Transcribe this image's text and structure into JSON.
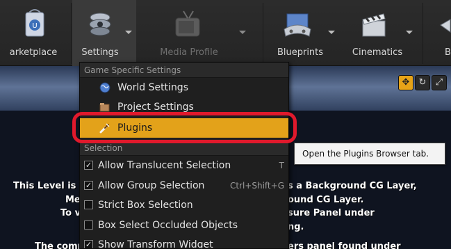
{
  "toolbar": {
    "buttons": [
      {
        "label": "arketplace",
        "icon": "marketplace-icon"
      },
      {
        "label": "Settings",
        "icon": "gear-icon"
      },
      {
        "label": "Media Profile",
        "icon": "media-profile-icon"
      },
      {
        "label": "Blueprints",
        "icon": "blueprints-icon"
      },
      {
        "label": "Cinematics",
        "icon": "clapperboard-icon"
      },
      {
        "label": "B",
        "icon": "build-icon"
      }
    ]
  },
  "menu": {
    "game_section": "Game Specific Settings",
    "world_settings": "World Settings",
    "project_settings": "Project Settings",
    "plugins": "Plugins",
    "selection_section": "Selection",
    "selection_items": [
      {
        "label": "Allow Translucent Selection",
        "shortcut": "T",
        "checked": true
      },
      {
        "label": "Allow Group Selection",
        "shortcut": "Ctrl+Shift+G",
        "checked": true
      },
      {
        "label": "Strict Box Selection",
        "shortcut": "",
        "checked": false
      },
      {
        "label": "Box Select Occluded Objects",
        "shortcut": "",
        "checked": false
      },
      {
        "label": "Show Transform Widget",
        "shortcut": "",
        "checked": true
      }
    ]
  },
  "tooltip": "Open the Plugins Browser tab.",
  "viewport": {
    "left_lines": [
      "This Level is s",
      "Me",
      "To vi",
      "The comp"
    ],
    "right_lines": [
      "s a Background CG Layer,",
      "ound CG Layer.",
      "sure Panel under",
      "ng.",
      "ers panel found under"
    ]
  },
  "colors": {
    "accent": "#e3a21a",
    "highlight_ring": "#e0192c"
  }
}
